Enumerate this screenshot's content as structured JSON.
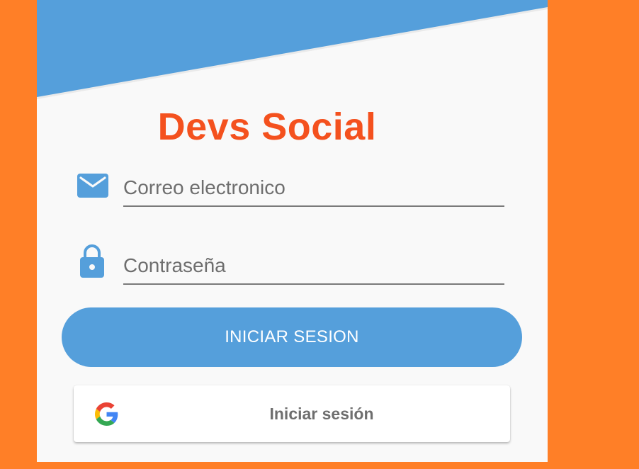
{
  "app": {
    "title": "Devs Social"
  },
  "form": {
    "email": {
      "placeholder": "Correo electronico",
      "value": "",
      "icon": "envelope-icon"
    },
    "password": {
      "placeholder": "Contraseña",
      "value": "",
      "icon": "lock-icon"
    }
  },
  "actions": {
    "login_label": "INICIAR SESION",
    "google_label": "Iniciar sesión",
    "google_icon": "google-icon"
  },
  "colors": {
    "background": "#FF7F27",
    "header": "#559FDB",
    "title": "#F4511E",
    "button": "#559FDB",
    "icon": "#559FDB"
  }
}
